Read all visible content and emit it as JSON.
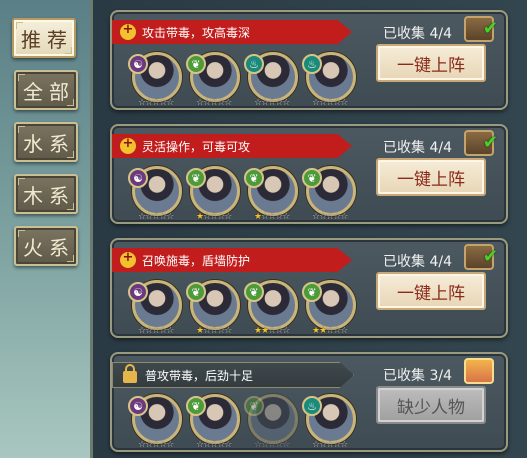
{
  "tabs": [
    {
      "label": "推荐",
      "active": true
    },
    {
      "label": "全部",
      "active": false
    },
    {
      "label": "水系",
      "active": false
    },
    {
      "label": "木系",
      "active": false
    },
    {
      "label": "火系",
      "active": false
    }
  ],
  "lineups": [
    {
      "title": "攻击带毒，攻高毒深",
      "collected": "已收集 4/4",
      "button": "一键上阵",
      "complete": true,
      "members": [
        {
          "element": "dark-icon",
          "stars": "☆☆☆☆☆",
          "gold": 0
        },
        {
          "element": "wood-icon",
          "stars": "☆☆☆☆☆",
          "gold": 0
        },
        {
          "element": "water-icon",
          "stars": "☆☆☆☆☆",
          "gold": 0
        },
        {
          "element": "water-icon",
          "stars": "☆☆☆☆☆",
          "gold": 0
        }
      ]
    },
    {
      "title": "灵活操作，可毒可攻",
      "collected": "已收集 4/4",
      "button": "一键上阵",
      "complete": true,
      "members": [
        {
          "element": "dark-icon",
          "stars": "☆☆☆☆☆",
          "gold": 0
        },
        {
          "element": "wood-icon",
          "stars": "☆☆☆☆☆",
          "gold": 1
        },
        {
          "element": "wood-icon",
          "stars": "☆☆☆☆☆",
          "gold": 1
        },
        {
          "element": "wood-icon",
          "stars": "☆☆☆☆☆",
          "gold": 0
        }
      ]
    },
    {
      "title": "召唤施毒，盾墙防护",
      "collected": "已收集 4/4",
      "button": "一键上阵",
      "complete": true,
      "members": [
        {
          "element": "dark-icon",
          "stars": "☆☆☆☆☆",
          "gold": 0
        },
        {
          "element": "wood-icon",
          "stars": "☆☆☆☆☆",
          "gold": 1
        },
        {
          "element": "wood-icon",
          "stars": "☆☆☆☆☆",
          "gold": 2
        },
        {
          "element": "wood-icon",
          "stars": "☆☆☆☆☆",
          "gold": 2
        }
      ]
    },
    {
      "title": "普攻带毒，后劲十足",
      "collected": "已收集 3/4",
      "button": "缺少人物",
      "complete": false,
      "members": [
        {
          "element": "dark-icon",
          "stars": "☆☆☆☆☆",
          "gold": 0
        },
        {
          "element": "wood-icon",
          "stars": "☆☆☆☆☆",
          "gold": 0
        },
        {
          "element": "wood-icon",
          "stars": "☆☆☆☆☆",
          "gold": 0
        },
        {
          "element": "water-icon",
          "stars": "☆☆☆☆☆",
          "gold": 0
        }
      ]
    }
  ],
  "colors": {
    "banner_red": "#c21d1d",
    "button_text": "#8b2a1a",
    "collected_check": "#48d12b"
  }
}
